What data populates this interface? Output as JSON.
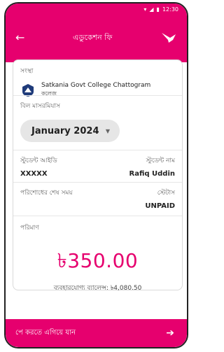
{
  "status": {
    "time": "12:30"
  },
  "appbar": {
    "title": "এডুকেশন ফি",
    "back_icon": "arrow-left-icon",
    "brand_icon": "bird-logo-icon"
  },
  "organization": {
    "label": "সংস্থা",
    "name": "Satkania Govt College Chattogram",
    "sub": "কলেজ"
  },
  "bill_month": {
    "label": "বিল মাসরমিযাস",
    "value": "January 2024"
  },
  "details": {
    "student_id_label": "স্টুডেন্ট আইডি",
    "student_id_value": "XXXXX",
    "student_name_label": "স্টুডেন্ট নাম",
    "student_name_value": "Rafiq Uddin",
    "due_label": "পরিশোধের শেষ সময়",
    "status_label": "স্টেটাস",
    "status_value": "UNPAID"
  },
  "amount": {
    "label": "পরিমাণ",
    "value": "৳350.00",
    "balance_text": "ব্যবহারযোগ্য ব্যালেন্স: ৳4,080.50"
  },
  "cta": {
    "label": "পে করতে এগিয়ে যান",
    "arrow_icon": "arrow-right-icon"
  },
  "colors": {
    "accent": "#e6006e"
  }
}
